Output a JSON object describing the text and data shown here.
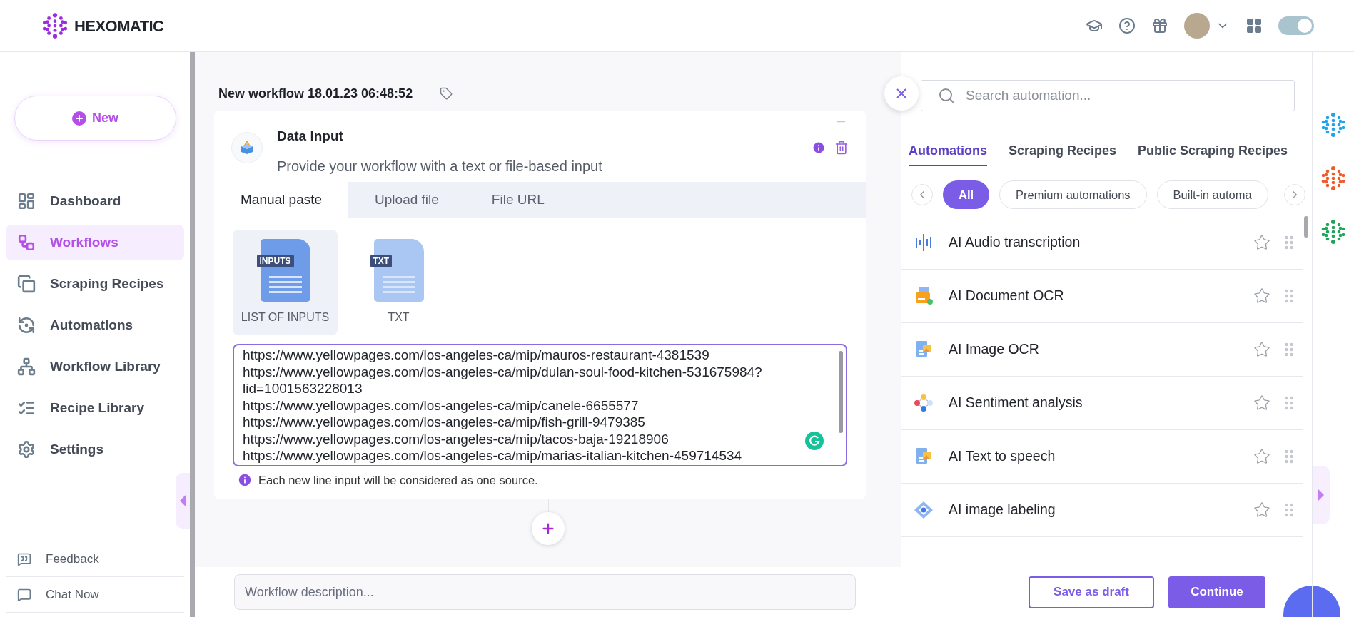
{
  "header": {
    "logo_text": "HEXOMATIC",
    "theme_toggle": {
      "on": true
    }
  },
  "sidebar": {
    "new_button": "New",
    "items": [
      {
        "label": "Dashboard",
        "selected": false
      },
      {
        "label": "Workflows",
        "selected": true
      },
      {
        "label": "Scraping Recipes",
        "selected": false
      },
      {
        "label": "Automations",
        "selected": false
      },
      {
        "label": "Workflow Library",
        "selected": false
      },
      {
        "label": "Recipe Library",
        "selected": false
      },
      {
        "label": "Settings",
        "selected": false
      }
    ],
    "footer_items": [
      {
        "label": "Feedback"
      },
      {
        "label": "Chat Now"
      }
    ]
  },
  "workflow": {
    "title": "New workflow 18.01.23 06:48:52",
    "step": {
      "title": "Data input",
      "description": "Provide your workflow with a text or file-based input",
      "tabs": [
        {
          "label": "Manual paste",
          "selected": true
        },
        {
          "label": "Upload file",
          "selected": false
        },
        {
          "label": "File URL",
          "selected": false
        }
      ],
      "input_types": [
        {
          "badge": "INPUTS",
          "label": "LIST OF INPUTS",
          "selected": true
        },
        {
          "badge": "TXT",
          "label": "TXT",
          "selected": false
        }
      ],
      "urls": [
        "https://www.yellowpages.com/los-angeles-ca/mip/mauros-restaurant-4381539",
        "https://www.yellowpages.com/los-angeles-ca/mip/dulan-soul-food-kitchen-531675984?lid=1001563228013",
        "https://www.yellowpages.com/los-angeles-ca/mip/canele-6655577",
        "https://www.yellowpages.com/los-angeles-ca/mip/fish-grill-9479385",
        "https://www.yellowpages.com/los-angeles-ca/mip/tacos-baja-19218906",
        "https://www.yellowpages.com/los-angeles-ca/mip/marias-italian-kitchen-459714534"
      ],
      "hint": "Each new line input will be considered as one source."
    }
  },
  "automation_panel": {
    "search": {
      "placeholder": "Search automation..."
    },
    "tabs": [
      {
        "label": "Automations",
        "selected": true
      },
      {
        "label": "Scraping Recipes",
        "selected": false
      },
      {
        "label": "Public Scraping Recipes",
        "selected": false
      }
    ],
    "filters": [
      {
        "label": "All",
        "selected": true
      },
      {
        "label": "Premium automations",
        "selected": false
      },
      {
        "label": "Built-in automa",
        "selected": false
      }
    ],
    "items": [
      {
        "name": "AI Audio transcription",
        "starred": false
      },
      {
        "name": "AI Document OCR",
        "starred": false
      },
      {
        "name": "AI Image OCR",
        "starred": false
      },
      {
        "name": "AI Sentiment analysis",
        "starred": false
      },
      {
        "name": "AI Text to speech",
        "starred": false
      },
      {
        "name": "AI image labeling",
        "starred": false
      }
    ]
  },
  "footer": {
    "description": {
      "placeholder": "Workflow description..."
    },
    "save_button": "Save as draft",
    "continue_button": "Continue"
  }
}
